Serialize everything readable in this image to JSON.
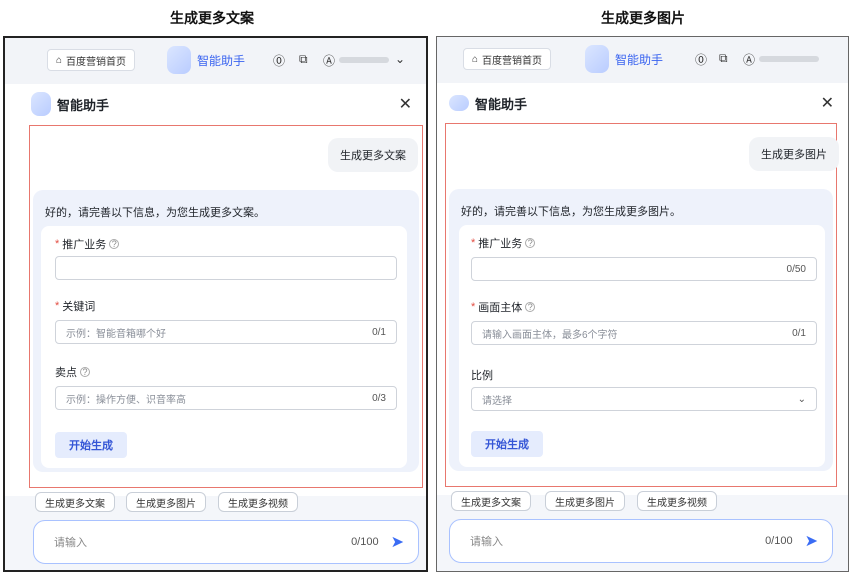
{
  "left": {
    "heading": "生成更多文案",
    "topbar": {
      "home_label": "百度营销首页",
      "assistant_label": "智能助手"
    },
    "header": {
      "title": "智能助手"
    },
    "user_message": "生成更多文案",
    "reply_text": "好的，请完善以下信息，为您生成更多文案。",
    "fields": [
      {
        "label": "推广业务",
        "required": true,
        "help": true,
        "placeholder": "",
        "count": ""
      },
      {
        "label": "关键词",
        "required": true,
        "help": false,
        "placeholder": "示例：智能音箱哪个好",
        "count": "0/1"
      },
      {
        "label": "卖点",
        "required": false,
        "help": true,
        "placeholder": "示例：操作方便、识音率高",
        "count": "0/3"
      }
    ],
    "start_button": "开始生成",
    "chips": [
      "生成更多文案",
      "生成更多图片",
      "生成更多视频"
    ],
    "input": {
      "placeholder": "请输入",
      "count": "0/100"
    }
  },
  "right": {
    "heading": "生成更多图片",
    "topbar": {
      "home_label": "百度营销首页",
      "assistant_label": "智能助手"
    },
    "header": {
      "title": "智能助手"
    },
    "user_message": "生成更多图片",
    "reply_text": "好的，请完善以下信息，为您生成更多图片。",
    "fields": [
      {
        "label": "推广业务",
        "required": true,
        "help": true,
        "placeholder": "",
        "count": "0/50"
      },
      {
        "label": "画面主体",
        "required": true,
        "help": true,
        "placeholder": "请输入画面主体，最多6个字符",
        "count": "0/1"
      },
      {
        "label": "比例",
        "required": false,
        "help": false,
        "placeholder": "请选择",
        "count": ""
      }
    ],
    "start_button": "开始生成",
    "chips": [
      "生成更多文案",
      "生成更多图片",
      "生成更多视频"
    ],
    "input": {
      "placeholder": "请输入",
      "count": "0/100"
    }
  },
  "colors": {
    "accent": "#3a6cf4",
    "frame": "#e8776e",
    "required": "#e34d42",
    "panel_bg": "#f4f6fa"
  },
  "icons": [
    "home-icon",
    "help-circle-icon",
    "copy-icon",
    "user-icon",
    "chevron-down-icon",
    "close-icon",
    "send-icon"
  ]
}
